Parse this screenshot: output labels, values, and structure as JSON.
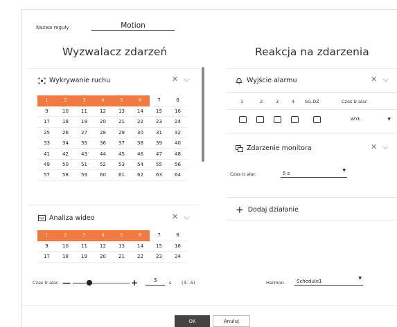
{
  "rule": {
    "label": "Nazwa reguły",
    "value": "Motion"
  },
  "trigger": {
    "heading": "Wyzwalacz zdarzeń",
    "motion": {
      "title": "Wykrywanie ruchu",
      "rows": [
        [
          "1",
          "2",
          "3",
          "4",
          "5",
          "6",
          "7",
          "8"
        ],
        [
          "9",
          "10",
          "11",
          "12",
          "13",
          "14",
          "15",
          "16"
        ],
        [
          "17",
          "18",
          "19",
          "20",
          "21",
          "22",
          "23",
          "24"
        ],
        [
          "25",
          "26",
          "27",
          "28",
          "29",
          "30",
          "31",
          "32"
        ],
        [
          "33",
          "34",
          "35",
          "36",
          "37",
          "38",
          "39",
          "40"
        ],
        [
          "41",
          "42",
          "43",
          "44",
          "45",
          "46",
          "47",
          "48"
        ],
        [
          "49",
          "50",
          "51",
          "52",
          "53",
          "54",
          "55",
          "56"
        ],
        [
          "57",
          "58",
          "59",
          "60",
          "61",
          "62",
          "63",
          "64"
        ]
      ],
      "selected": [
        "1",
        "2",
        "3",
        "4",
        "5",
        "6"
      ]
    },
    "video": {
      "title": "Analiza wideo",
      "rows": [
        [
          "1",
          "2",
          "3",
          "4",
          "5",
          "6",
          "7",
          "8"
        ],
        [
          "9",
          "10",
          "11",
          "12",
          "13",
          "14",
          "15",
          "16"
        ],
        [
          "17",
          "18",
          "19",
          "20",
          "21",
          "22",
          "23",
          "24"
        ]
      ],
      "selected": [
        "1",
        "2",
        "3",
        "4",
        "5",
        "6"
      ]
    },
    "duration": {
      "label": "Czas tr.alar.",
      "value": "3",
      "unit": "s",
      "range": "(3...5)",
      "level": 0
    }
  },
  "reaction": {
    "heading": "Reakcja na zdarzenia",
    "alarm": {
      "title": "Wyjście alarmu",
      "columns": [
        "1",
        "2",
        "3",
        "4",
        "SG.DŹ",
        "Czas tr.alar."
      ],
      "duration_value": "WYŁ."
    },
    "monitor": {
      "title": "Zdarzenie monitora",
      "duration_label": "Czas tr.alar.",
      "duration_value": "5 s"
    },
    "add_action": "Dodaj działanie",
    "schedule": {
      "label": "Harmon.",
      "value": "Schedule1"
    }
  },
  "buttons": {
    "ok": "OK",
    "cancel": "Anuluj"
  }
}
